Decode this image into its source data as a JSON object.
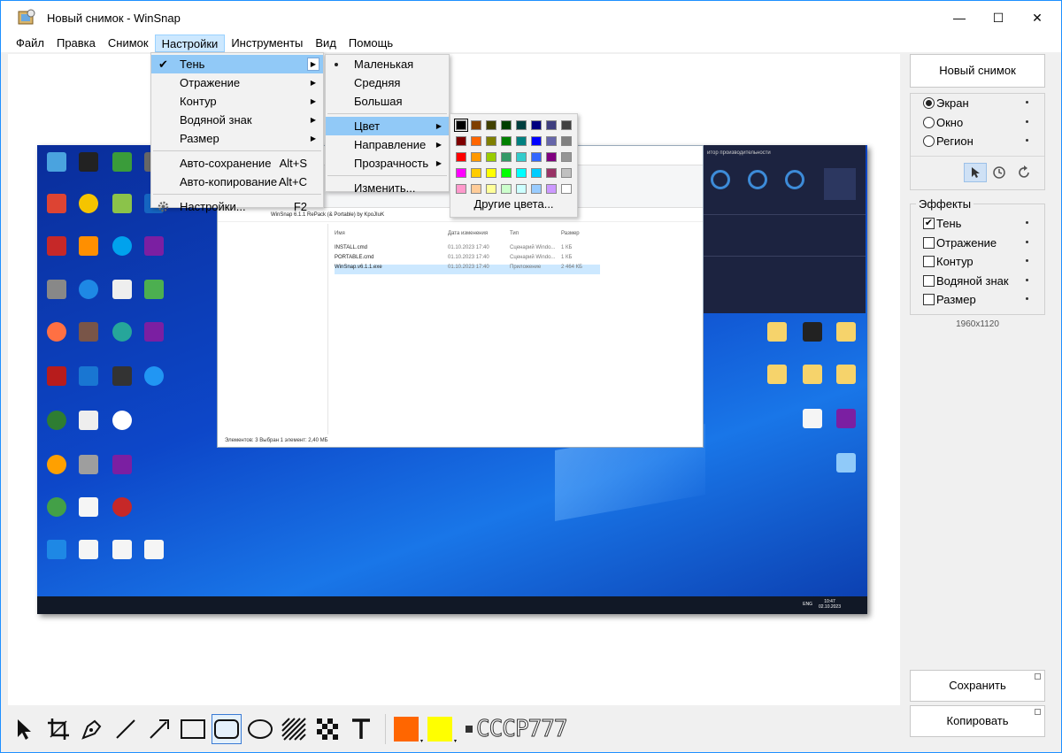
{
  "window": {
    "title": "Новый снимок - WinSnap",
    "minimize_glyph": "—",
    "maximize_glyph": "☐",
    "close_glyph": "✕"
  },
  "menubar": [
    {
      "label": "Файл"
    },
    {
      "label": "Правка"
    },
    {
      "label": "Снимок"
    },
    {
      "label": "Настройки"
    },
    {
      "label": "Инструменты"
    },
    {
      "label": "Вид"
    },
    {
      "label": "Помощь"
    }
  ],
  "settings_menu": {
    "items": [
      {
        "label": "Тень",
        "checked": true,
        "submenu": true
      },
      {
        "label": "Отражение",
        "submenu": true
      },
      {
        "label": "Контур",
        "submenu": true
      },
      {
        "label": "Водяной знак",
        "submenu": true
      },
      {
        "label": "Размер",
        "submenu": true
      }
    ],
    "items2": [
      {
        "label": "Авто-сохранение",
        "shortcut": "Alt+S"
      },
      {
        "label": "Авто-копирование",
        "shortcut": "Alt+C"
      }
    ],
    "items3": [
      {
        "label": "Настройки...",
        "shortcut": "F2"
      }
    ]
  },
  "shadow_menu": {
    "sizes": [
      "Маленькая",
      "Средняя",
      "Большая"
    ],
    "items": [
      {
        "label": "Цвет",
        "submenu": true
      },
      {
        "label": "Направление",
        "submenu": true
      },
      {
        "label": "Прозрачность",
        "submenu": true
      }
    ],
    "change": "Изменить..."
  },
  "color_menu": {
    "other": "Другие цвета...",
    "colors": [
      "#000000",
      "#7f3f00",
      "#404000",
      "#003f00",
      "#003f3f",
      "#00007f",
      "#3f3f7f",
      "#3f3f3f",
      "#7f0000",
      "#ff6600",
      "#7f7f00",
      "#008000",
      "#008080",
      "#0000ff",
      "#6666aa",
      "#808080",
      "#ff0000",
      "#ff9900",
      "#99cc00",
      "#339966",
      "#33cccc",
      "#3366ff",
      "#800080",
      "#969696",
      "#ff00ff",
      "#ffcc00",
      "#ffff00",
      "#00ff00",
      "#00ffff",
      "#00ccff",
      "#993366",
      "#c0c0c0",
      "#ff99cc",
      "#ffcc99",
      "#ffff99",
      "#ccffcc",
      "#ccffff",
      "#99ccff",
      "#cc99ff",
      "#ffffff"
    ]
  },
  "right_panel": {
    "new_snapshot": "Новый снимок",
    "modes": [
      {
        "label": "Экран",
        "selected": true
      },
      {
        "label": "Окно",
        "selected": false
      },
      {
        "label": "Регион",
        "selected": false
      }
    ],
    "effects_title": "Эффекты",
    "effects": [
      {
        "label": "Тень",
        "checked": true
      },
      {
        "label": "Отражение",
        "checked": false
      },
      {
        "label": "Контур",
        "checked": false
      },
      {
        "label": "Водяной знак",
        "checked": false
      },
      {
        "label": "Размер",
        "checked": false
      }
    ],
    "resolution": "1960x1120",
    "save": "Сохранить",
    "copy": "Копировать"
  },
  "toolbar": {
    "fill_color": "#ff6600",
    "stroke_color": "#ffff00",
    "stamp_text": "СССР777"
  },
  "screenshot": {
    "explorer_path": "WinSnap 6.1.1 RePack (& Portable) by KpoJIuK",
    "files": [
      {
        "name": "INSTALL.cmd",
        "date": "01.10.2023 17:40",
        "type": "Сценарий Windo...",
        "size": "1 КБ"
      },
      {
        "name": "PORTABLE.cmd",
        "date": "01.10.2023 17:40",
        "type": "Сценарий Windo...",
        "size": "1 КБ"
      },
      {
        "name": "WinSnap.v6.1.1.exe",
        "date": "01.10.2023 17:40",
        "type": "Приложение",
        "size": "2 464 КБ"
      }
    ],
    "columns": [
      "Имя",
      "Дата изменения",
      "Тип",
      "Размер"
    ],
    "status": "Элементов: 3    Выбран 1 элемент: 2,40 МБ",
    "perf_title": "итор производительности",
    "clock": "10:47",
    "date": "02.10.2023",
    "lang": "ENG"
  }
}
